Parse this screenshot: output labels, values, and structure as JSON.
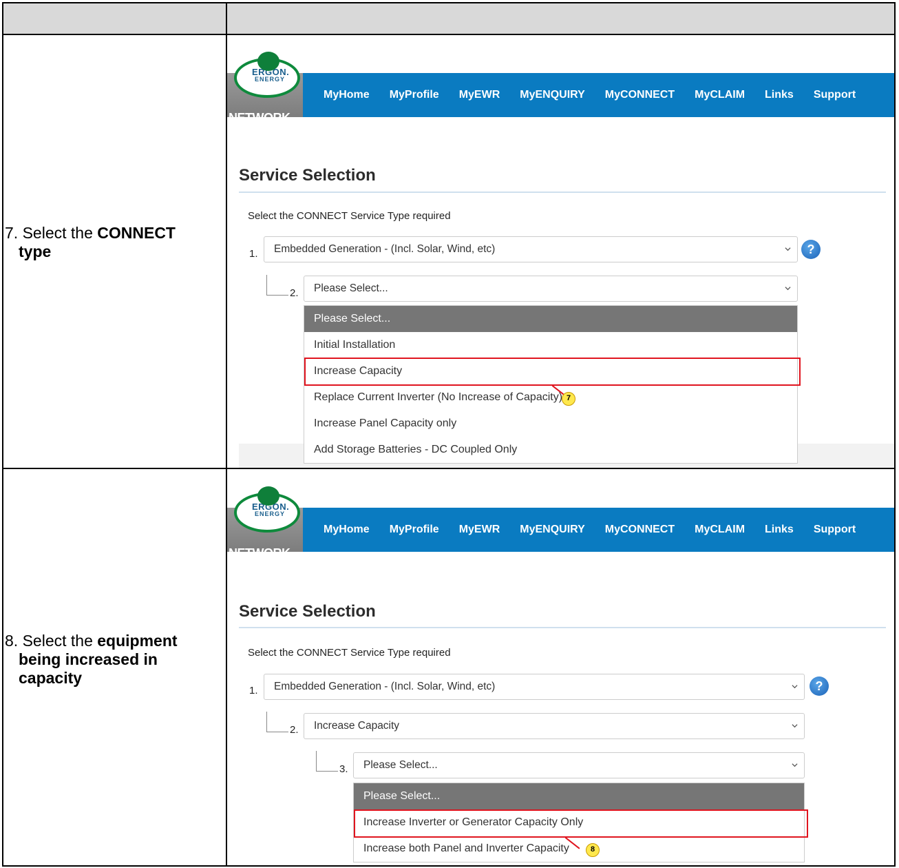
{
  "steps": [
    {
      "number": "7.",
      "instruction_pre": "Select the ",
      "instruction_bold": "CONNECT",
      "instruction_line2_bold": "type",
      "nav": [
        "MyHome",
        "MyProfile",
        "MyEWR",
        "MyENQUIRY",
        "MyCONNECT",
        "MyCLAIM",
        "Links",
        "Support"
      ],
      "logo": {
        "ergon": "ERGON.",
        "energy": "ENERGY",
        "network": "NETWORK"
      },
      "title": "Service Selection",
      "prompt": "Select the CONNECT Service Type required",
      "select1_num": "1.",
      "select1_value": "Embedded Generation - (Incl. Solar, Wind, etc)",
      "select2_num": "2.",
      "select2_value": "Please Select...",
      "help": "?",
      "options": [
        "Please Select...",
        "Initial Installation",
        "Increase Capacity",
        "Replace Current Inverter (No Increase of Capacity)",
        "Increase Panel Capacity only",
        "Add Storage Batteries - DC Coupled Only"
      ],
      "callout": "7"
    },
    {
      "number": "8.",
      "instruction_pre": "Select the ",
      "instruction_bold": "equipment",
      "instruction_line2_bold": "being increased in",
      "instruction_line3_bold": "capacity",
      "nav": [
        "MyHome",
        "MyProfile",
        "MyEWR",
        "MyENQUIRY",
        "MyCONNECT",
        "MyCLAIM",
        "Links",
        "Support"
      ],
      "logo": {
        "ergon": "ERGON.",
        "energy": "ENERGY",
        "network": "NETWORK"
      },
      "title": "Service Selection",
      "prompt": "Select the CONNECT Service Type required",
      "select1_num": "1.",
      "select1_value": "Embedded Generation - (Incl. Solar, Wind, etc)",
      "select2_num": "2.",
      "select2_value": "Increase Capacity",
      "select3_num": "3.",
      "select3_value": "Please Select...",
      "help": "?",
      "options": [
        "Please Select...",
        "Increase Inverter or Generator Capacity Only",
        "Increase both Panel and Inverter Capacity"
      ],
      "callout": "8"
    }
  ],
  "colors": {
    "nav_bg": "#0a7bc1",
    "highlight": "#e0141e",
    "header_bg": "#d9d9d9"
  }
}
